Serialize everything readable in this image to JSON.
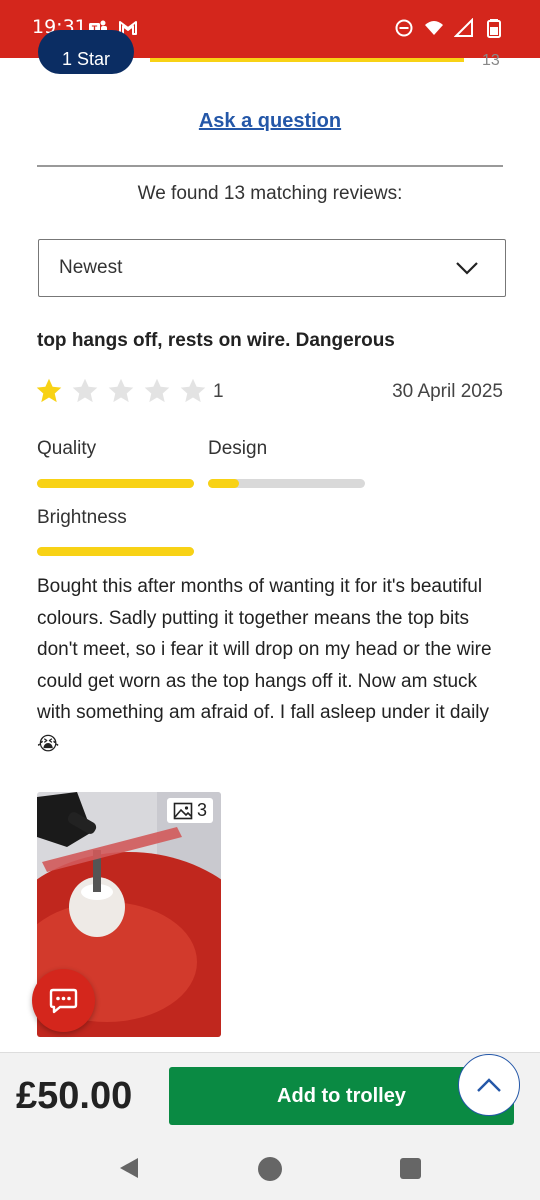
{
  "status_bar": {
    "time": "19:31",
    "left_icons": [
      "teams-icon",
      "gmail-icon"
    ],
    "right_icons": [
      "do-not-disturb-icon",
      "wifi-icon",
      "signal-icon",
      "battery-icon"
    ]
  },
  "peek": {
    "pill_label": "1 Star",
    "count": "13"
  },
  "ask_question": "Ask a question",
  "found_text": "We found 13 matching reviews:",
  "sort": {
    "selected": "Newest"
  },
  "review": {
    "title": "top hangs off, rests on wire. Dangerous",
    "rating": 1,
    "rating_label": "1",
    "max_rating": 5,
    "date": "30 April 2025",
    "attributes": [
      {
        "label": "Quality",
        "level": 1.0
      },
      {
        "label": "Design",
        "level": 0.2
      },
      {
        "label": "Brightness",
        "level": 1.0
      }
    ],
    "text": "Bought this after months of wanting it for it's beautiful colours. Sadly putting it together means the top bits don't meet, so i fear it will drop on my head or the wire could get worn as the top hangs off it. Now am stuck with something am afraid of. I fall asleep under it daily 😭",
    "photo_count": "3"
  },
  "bottom": {
    "price": "£50.00",
    "add_label": "Add to trolley"
  },
  "colors": {
    "brand_red": "#d4261c",
    "navy": "#0b2d63",
    "link_blue": "#2457a8",
    "star_yellow": "#f8d215",
    "add_green": "#0a8a43"
  }
}
